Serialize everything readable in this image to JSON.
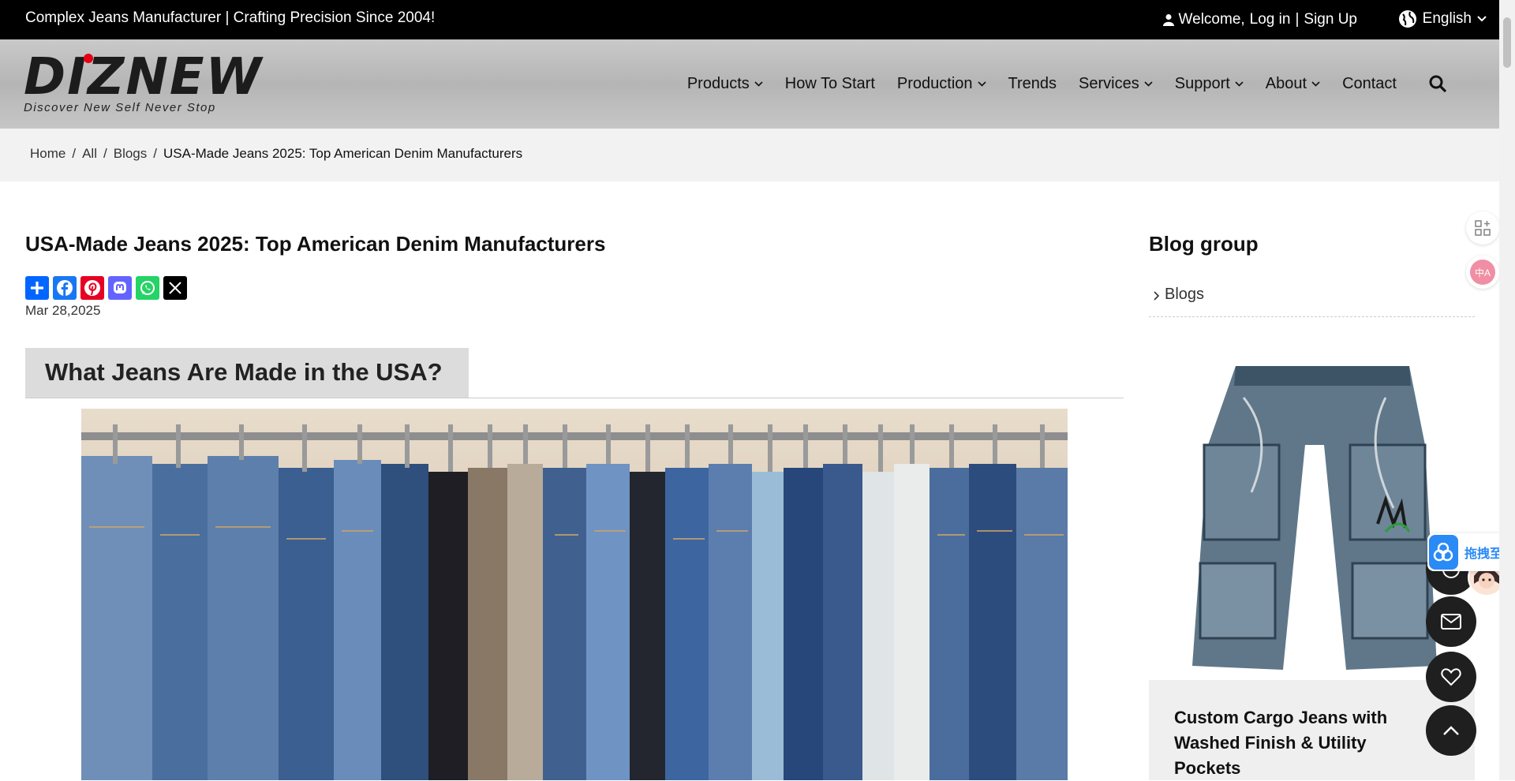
{
  "topbar": {
    "tagline": "Complex Jeans Manufacturer | Crafting Precision Since 2004!",
    "welcome": "Welcome,",
    "login": "Log in",
    "divider": "|",
    "signup": "Sign Up",
    "language": "English"
  },
  "logo": {
    "brand": "DIZNEW",
    "slogan": "Discover New Self Never Stop"
  },
  "nav": {
    "items": [
      {
        "label": "Products",
        "dropdown": true
      },
      {
        "label": "How To Start",
        "dropdown": false
      },
      {
        "label": "Production",
        "dropdown": true
      },
      {
        "label": "Trends",
        "dropdown": false
      },
      {
        "label": "Services",
        "dropdown": true
      },
      {
        "label": "Support",
        "dropdown": true
      },
      {
        "label": "About",
        "dropdown": true
      },
      {
        "label": "Contact",
        "dropdown": false
      }
    ]
  },
  "breadcrumb": {
    "items": [
      "Home",
      "All",
      "Blogs"
    ],
    "sep": "/",
    "current": "USA-Made Jeans 2025: Top American Denim Manufacturers"
  },
  "article": {
    "title": "USA-Made Jeans 2025: Top American Denim Manufacturers",
    "date": "Mar 28,2025",
    "heading": "What Jeans Are Made in the USA?",
    "share_icons": [
      "share-plus-icon",
      "facebook-icon",
      "pinterest-icon",
      "mastodon-icon",
      "whatsapp-icon",
      "x-icon"
    ]
  },
  "sidebar": {
    "title": "Blog group",
    "link": "Blogs",
    "product_name": "Custom Cargo Jeans with Washed Finish & Utility Pockets"
  },
  "floating": {
    "drag_text": "拖拽至此",
    "translate_text": "中A"
  },
  "colors": {
    "facebook": "#1877f2",
    "pinterest": "#e60023",
    "mastodon": "#6364ff",
    "whatsapp": "#25d366",
    "share": "#0166ff",
    "x": "#000000",
    "accent_red": "#e60012"
  }
}
